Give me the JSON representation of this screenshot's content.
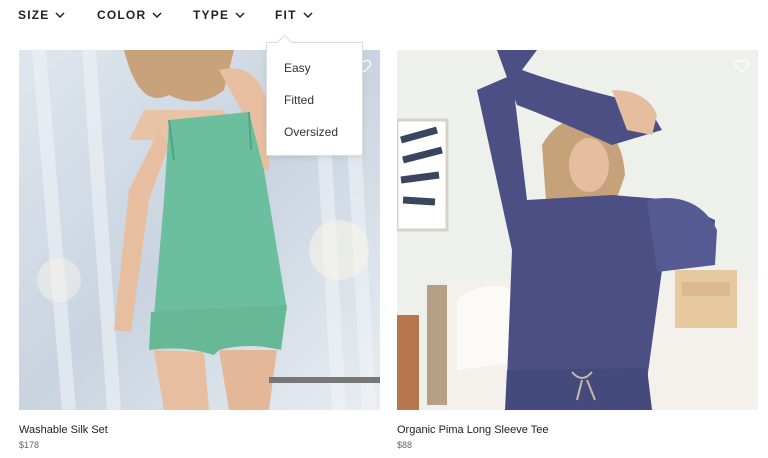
{
  "filters": [
    {
      "label": "SIZE",
      "icon": "chevron-down-icon"
    },
    {
      "label": "COLOR",
      "icon": "chevron-down-icon"
    },
    {
      "label": "TYPE",
      "icon": "chevron-down-icon"
    },
    {
      "label": "FIT",
      "icon": "chevron-down-icon"
    }
  ],
  "fit_dropdown": {
    "options": [
      "Easy",
      "Fitted",
      "Oversized"
    ]
  },
  "products": [
    {
      "name": "Washable Silk Set",
      "price": "$178",
      "image_alt": "woman in green silk camisole and shorts"
    },
    {
      "name": "Organic Pima Long Sleeve Tee",
      "price": "$88",
      "image_alt": "woman in navy long sleeve tee in bedroom"
    }
  ],
  "colors": {
    "accent_text": "#222222",
    "green": "#6cbf9e",
    "navy": "#4b4f84"
  }
}
